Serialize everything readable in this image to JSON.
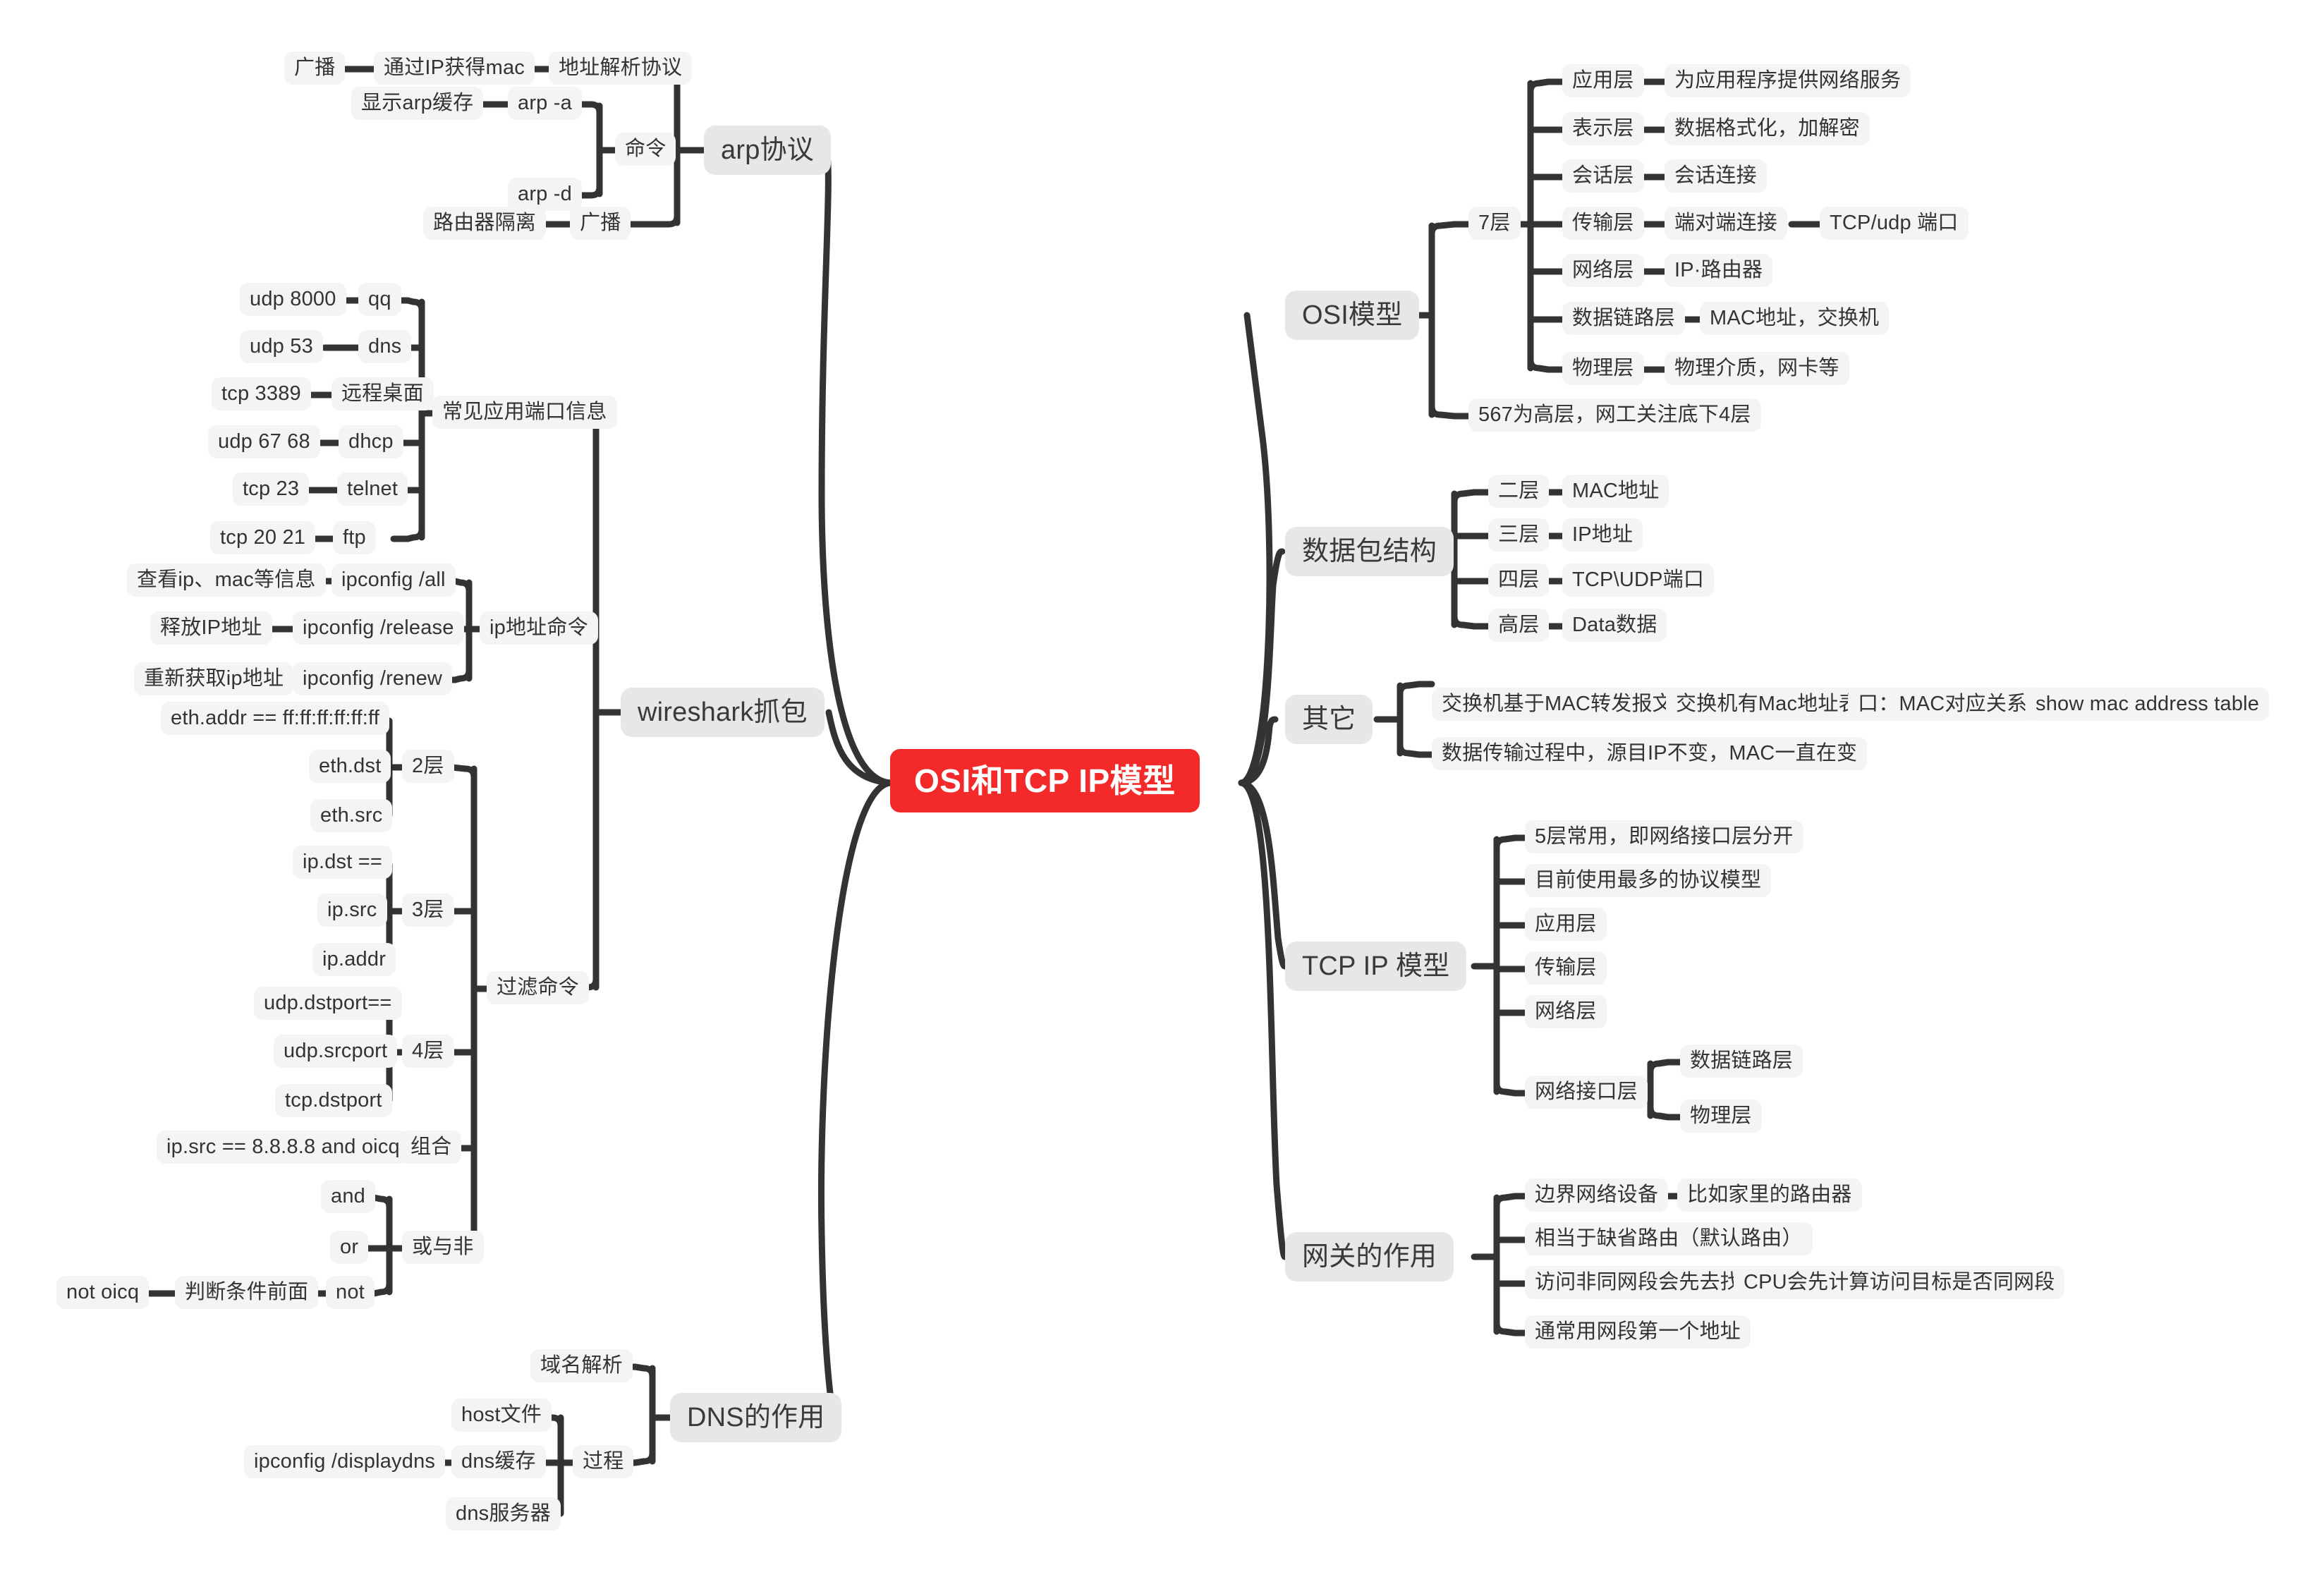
{
  "meta": {
    "title": "OSI和TCP IP模型",
    "type": "mindmap",
    "colors": {
      "root_bg": "#f42a2a",
      "root_text": "#ffffff",
      "branch_bg": "#e7e7e7",
      "leaf_bg": "#f4f4f4",
      "text": "#333333",
      "wire": "#333333",
      "canvas_bg": "#ffffff"
    }
  },
  "root": {
    "label": "OSI和TCP IP模型"
  },
  "branches": {
    "arp": {
      "label": "arp协议",
      "children": {
        "addr_resolution": {
          "label": "地址解析协议"
        },
        "get_mac_by_ip": {
          "label": "通过IP获得mac"
        },
        "broadcast_leaf": {
          "label": "广播"
        },
        "command": {
          "label": "命令"
        },
        "arp_a": {
          "label": "arp -a"
        },
        "show_arp_cache": {
          "label": "显示arp缓存"
        },
        "arp_d": {
          "label": "arp -d"
        },
        "broadcast": {
          "label": "广播"
        },
        "router_isolation": {
          "label": "路由器隔离"
        }
      }
    },
    "wireshark": {
      "label": "wireshark抓包",
      "ports": {
        "label": "常见应用端口信息",
        "rows": [
          {
            "port": "udp 8000",
            "app": "qq"
          },
          {
            "port": "udp 53",
            "app": "dns"
          },
          {
            "port": "tcp 3389",
            "app": "远程桌面"
          },
          {
            "port": "udp 67 68",
            "app": "dhcp"
          },
          {
            "port": "tcp 23",
            "app": "telnet"
          },
          {
            "port": "tcp 20 21",
            "app": "ftp"
          }
        ]
      },
      "ip_commands": {
        "label": "ip地址命令",
        "rows": [
          {
            "cmd": "ipconfig /all",
            "desc": "查看ip、mac等信息"
          },
          {
            "cmd": "ipconfig /release",
            "desc": "释放IP地址"
          },
          {
            "cmd": "ipconfig /renew",
            "desc": "重新获取ip地址"
          }
        ]
      },
      "filter_commands": {
        "label": "过滤命令",
        "layer2": {
          "label": "2层",
          "items": [
            {
              "label": "eth.addr == ff:ff:ff:ff:ff:ff"
            },
            {
              "label": "eth.dst"
            },
            {
              "label": "eth.src"
            }
          ]
        },
        "layer3": {
          "label": "3层",
          "items": [
            {
              "label": "ip.dst =="
            },
            {
              "label": "ip.src"
            },
            {
              "label": "ip.addr"
            }
          ]
        },
        "layer4": {
          "label": "4层",
          "items": [
            {
              "label": "udp.dstport=="
            },
            {
              "label": "udp.srcport"
            },
            {
              "label": "tcp.dstport"
            }
          ]
        },
        "combination": {
          "label": "组合",
          "example": "ip.src == 8.8.8.8 and oicq"
        },
        "logic": {
          "label": "或与非",
          "and": "and",
          "or": "or",
          "not": "not",
          "not_desc": "判断条件前面",
          "not_example": "not oicq"
        }
      }
    },
    "dns": {
      "label": "DNS的作用",
      "children": {
        "domain_resolution": {
          "label": "域名解析"
        },
        "process": {
          "label": "过程"
        },
        "host_file": {
          "label": "host文件"
        },
        "dns_cache": {
          "label": "dns缓存"
        },
        "displaydns": {
          "label": "ipconfig /displaydns"
        },
        "dns_server": {
          "label": "dns服务器"
        }
      }
    },
    "osi": {
      "label": "OSI模型",
      "seven_layers": {
        "label": "7层"
      },
      "note": "567为高层，网工关注底下4层",
      "layers": [
        {
          "name": "应用层",
          "desc": "为应用程序提供网络服务",
          "extra": ""
        },
        {
          "name": "表示层",
          "desc": "数据格式化，加解密",
          "extra": ""
        },
        {
          "name": "会话层",
          "desc": "会话连接",
          "extra": ""
        },
        {
          "name": "传输层",
          "desc": "端对端连接",
          "extra": "TCP/udp 端口"
        },
        {
          "name": "网络层",
          "desc": "IP·路由器",
          "extra": ""
        },
        {
          "name": "数据链路层",
          "desc": "MAC地址，交换机",
          "extra": ""
        },
        {
          "name": "物理层",
          "desc": "物理介质，网卡等",
          "extra": ""
        }
      ]
    },
    "packet": {
      "label": "数据包结构",
      "rows": [
        {
          "layer": "二层",
          "content": "MAC地址"
        },
        {
          "layer": "三层",
          "content": "IP地址"
        },
        {
          "layer": "四层",
          "content": "TCP\\UDP端口"
        },
        {
          "layer": "高层",
          "content": "Data数据"
        }
      ]
    },
    "other": {
      "label": "其它",
      "chain": [
        "交换机基于MAC转发报文",
        "交换机有Mac地址表",
        "口：MAC对应关系",
        "show mac address table"
      ],
      "note": "数据传输过程中，源目IP不变，MAC一直在变"
    },
    "tcpip": {
      "label": "TCP IP 模型",
      "items": [
        "5层常用，即网络接口层分开",
        "目前使用最多的协议模型",
        "应用层",
        "传输层",
        "网络层"
      ],
      "interface_layer": {
        "label": "网络接口层",
        "children": [
          "数据链路层",
          "物理层"
        ]
      }
    },
    "gateway": {
      "label": "网关的作用",
      "items": [
        {
          "label": "边界网络设备",
          "extra": "比如家里的路由器"
        },
        {
          "label": "相当于缺省路由（默认路由）",
          "extra": ""
        },
        {
          "label": "访问非同网段会先去找网关",
          "extra": "CPU会先计算访问目标是否同网段"
        },
        {
          "label": "通常用网段第一个地址",
          "extra": ""
        }
      ]
    }
  }
}
